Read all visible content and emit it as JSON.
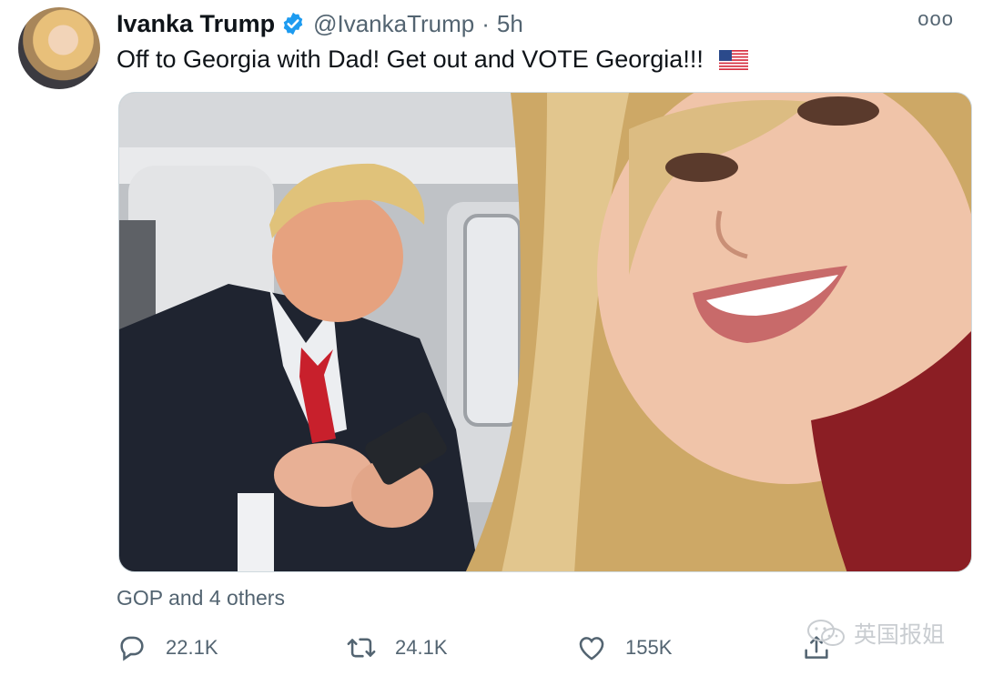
{
  "tweet": {
    "author_name": "Ivanka Trump",
    "handle": "@IvankaTrump",
    "separator": "·",
    "time": "5h",
    "more_glyph": "ooo",
    "text": "Off to Georgia with Dad! Get out and VOTE Georgia!!!",
    "flag_icon": "us-flag-icon",
    "tagged": "GOP and 4 others"
  },
  "actions": {
    "reply_count": "22.1K",
    "retweet_count": "24.1K",
    "like_count": "155K"
  },
  "watermark": {
    "text": "英国报姐"
  },
  "colors": {
    "verified": "#1d9bf0",
    "muted": "#536471",
    "border": "#cfd9de"
  }
}
